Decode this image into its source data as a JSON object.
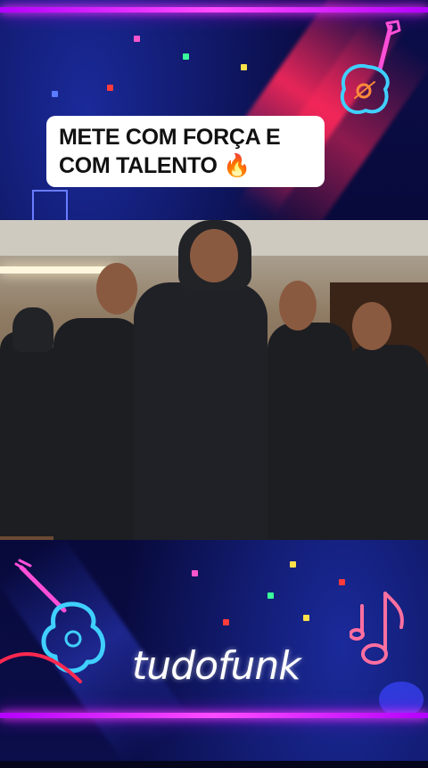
{
  "caption": {
    "line1": "METE COM FORÇA E",
    "line2": "COM TALENTO 🔥"
  },
  "brand": {
    "name": "tudofunk"
  },
  "icons": [
    "guitar-icon",
    "guitar-icon",
    "music-note-icon",
    "fire-emoji"
  ],
  "colors": {
    "neon_border": "#ff40ff",
    "neon_guitar": "#3fd0ff",
    "accent_red": "#ff2850",
    "background": "#060730"
  }
}
